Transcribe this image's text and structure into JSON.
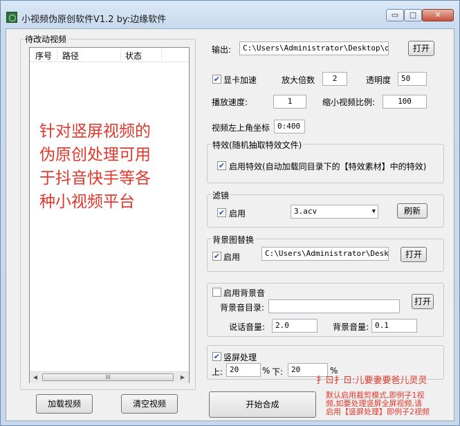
{
  "window": {
    "title": "小视频伪原创软件V1.2 by:边缘软件",
    "min_glyph": "▭",
    "max_glyph": "□",
    "close_glyph": "✕"
  },
  "left": {
    "group_title": "待改动视频",
    "columns": [
      "序号",
      "路径",
      "状态"
    ],
    "watermark_lines": [
      "针对竖屏视频的",
      "伪原创处理可用",
      "于抖音快手等各",
      "种小视频平台"
    ],
    "scroll_left": "◀",
    "scroll_right": "▶",
    "scroll_grip": "III",
    "load_button": "加载视频",
    "clear_button": "清空视频"
  },
  "output": {
    "label": "输出:",
    "path": "C:\\Users\\Administrator\\Desktop\\ok",
    "open_button": "打开"
  },
  "options": {
    "gpu_label": "显卡加速",
    "gpu_checked": true,
    "zoom_label": "放大倍数",
    "zoom_value": "2",
    "opacity_label": "透明度",
    "opacity_value": "50",
    "speed_label": "播放速度:",
    "speed_value": "1",
    "shrink_label": "缩小视频比例:",
    "shrink_value": "100",
    "coord_label": "视频左上角坐标",
    "coord_value": "0:400"
  },
  "effects": {
    "group_title": "特效(随机抽取特效文件)",
    "enable_label": "启用特效(自动加载同目录下的【特效素材】中的特效)",
    "checked": true
  },
  "filter": {
    "group_title": "滤镜",
    "enable_label": "启用",
    "checked": true,
    "selected": "3.acv",
    "refresh_button": "刷新"
  },
  "background_image": {
    "group_title": "背景图替换",
    "enable_label": "启用",
    "checked": true,
    "path": "C:\\Users\\Administrator\\Desktop",
    "open_button": "打开"
  },
  "background_audio": {
    "enable_label": "启用背景音",
    "checked": false,
    "dir_label": "背景音目录:",
    "dir_value": "",
    "open_button": "打开",
    "voice_label": "说话音量:",
    "voice_value": "2.0",
    "bg_volume_label": "背景音量:",
    "bg_volume_value": "0.1"
  },
  "vertical": {
    "enable_label": "竖屏处理",
    "checked": true,
    "top_label": "上:",
    "top_value": "20",
    "top_unit": "%",
    "bottom_label": "下:",
    "bottom_value": "20",
    "bottom_unit": "%"
  },
  "notes": {
    "garbled": "扌ㄖ扌ㄖ:儿要妻要爸儿灵灵",
    "crop_note_lines": [
      "默认启用裁剪模式,即例子1视",
      "频,如要处理竖屏全屏视频,请",
      "启用【竖屏处理】即例子2视频"
    ]
  },
  "start_button": "开始合成",
  "colors": {
    "accent_red": "#e2372a",
    "title_gradient_top": "#dbe8f6",
    "client_bg": "#f0f0f0"
  }
}
